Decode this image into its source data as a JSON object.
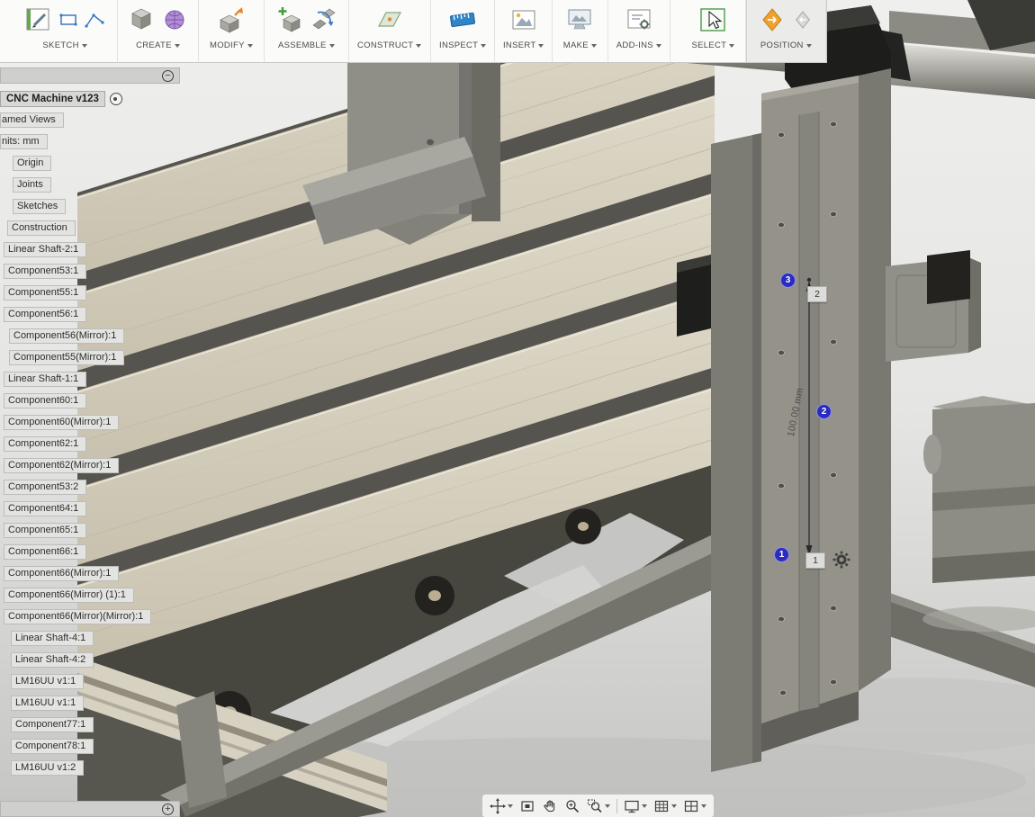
{
  "toolbar": {
    "groups": [
      {
        "label": "SKETCH"
      },
      {
        "label": "CREATE"
      },
      {
        "label": "MODIFY"
      },
      {
        "label": "ASSEMBLE"
      },
      {
        "label": "CONSTRUCT"
      },
      {
        "label": "INSPECT"
      },
      {
        "label": "INSERT"
      },
      {
        "label": "MAKE"
      },
      {
        "label": "ADD-INS"
      },
      {
        "label": "SELECT"
      },
      {
        "label": "POSITION"
      }
    ]
  },
  "browser": {
    "root_label": "CNC Machine v123",
    "collapse_glyph": "−",
    "expand_glyph": "+",
    "items": [
      "amed Views",
      "nits: mm",
      "Origin",
      "Joints",
      "Sketches",
      "Construction",
      "Linear Shaft-2:1",
      "Component53:1",
      "Component55:1",
      "Component56:1",
      "Component56(Mirror):1",
      "Component55(Mirror):1",
      "Linear Shaft-1:1",
      "Component60:1",
      "Component60(Mirror):1",
      "Component62:1",
      "Component62(Mirror):1",
      "Component53:2",
      "Component64:1",
      "Component65:1",
      "Component66:1",
      "Component66(Mirror):1",
      "Component66(Mirror) (1):1",
      "Component66(Mirror)(Mirror):1",
      "Linear Shaft-4:1",
      "Linear Shaft-4:2",
      "LM16UU v1:1",
      "LM16UU v1:1",
      "Component77:1",
      "Component78:1",
      "LM16UU v1:2"
    ]
  },
  "viewport": {
    "dimension_label": "100.00 mm",
    "markers": [
      {
        "number": "1"
      },
      {
        "number": "2"
      },
      {
        "number": "3"
      }
    ],
    "joint_tags": {
      "top": "2",
      "bottom": "1"
    }
  },
  "colors": {
    "marker_blue": "#2b2bbd",
    "slat_tan": "#d5cebc",
    "frame_gray": "#8f8e87",
    "motor_black": "#1d1d1b"
  }
}
